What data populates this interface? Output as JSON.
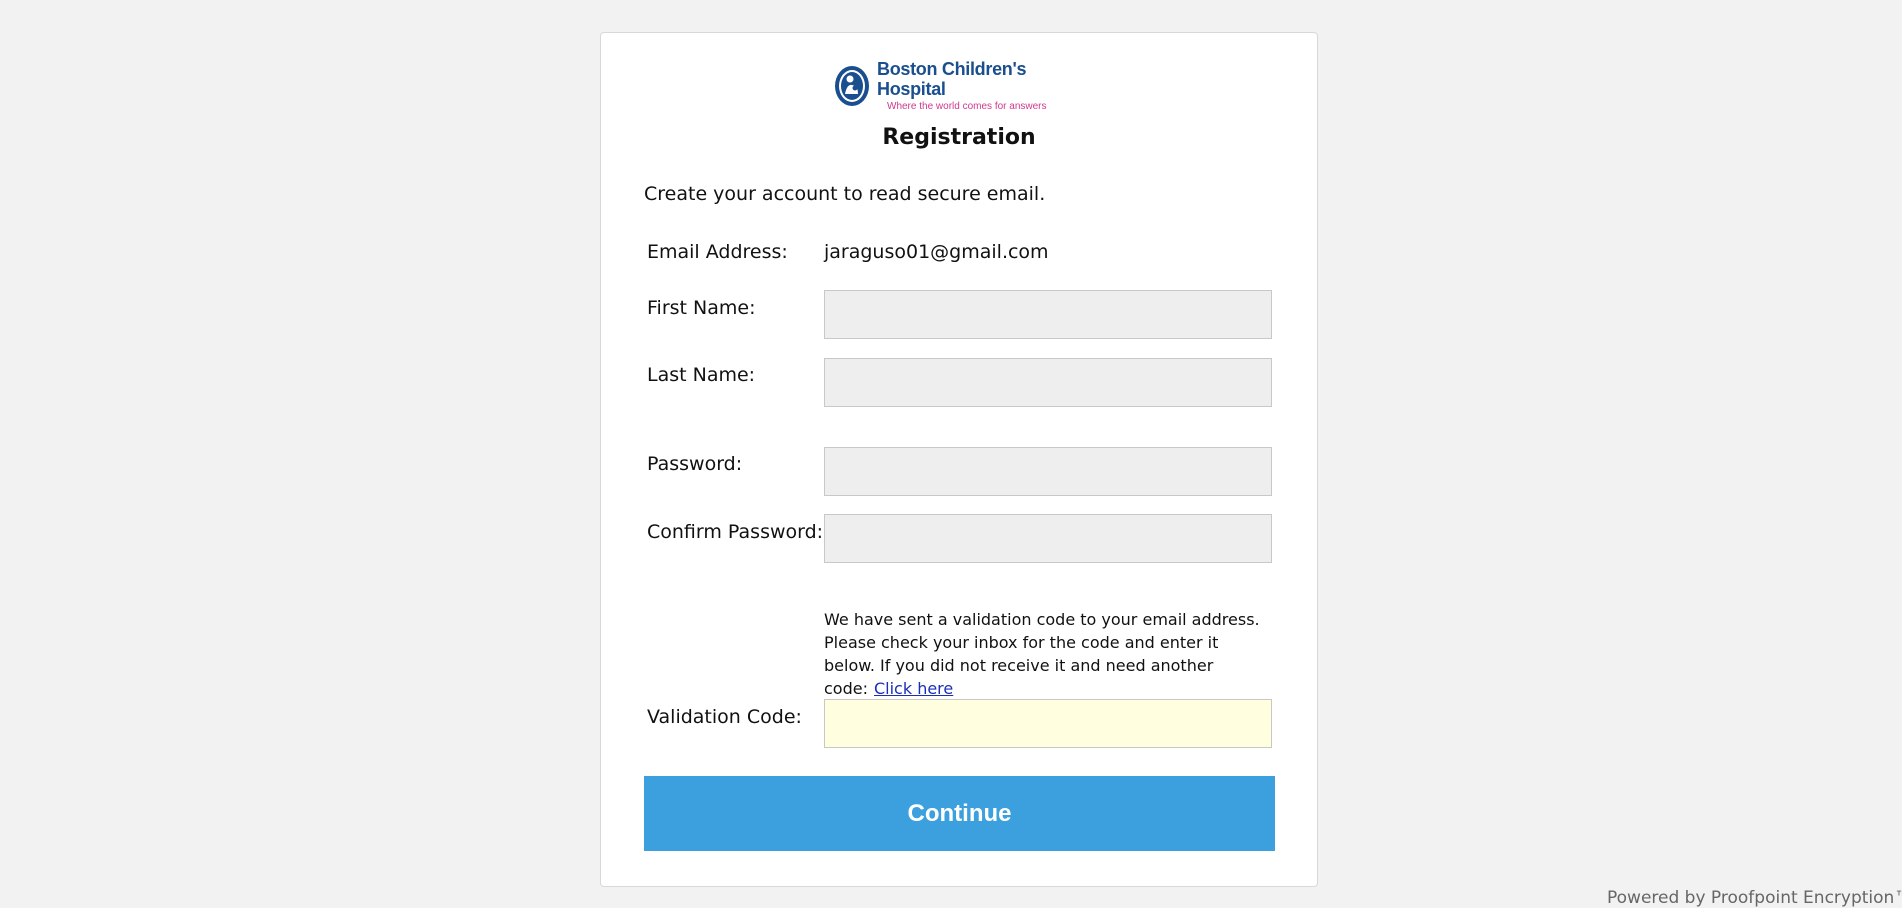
{
  "logo": {
    "name": "Boston Children's Hospital",
    "tagline": "Where the world comes for answers",
    "name_color": "#1a4f8f",
    "tagline_color": "#d0388f"
  },
  "form": {
    "title": "Registration",
    "intro": "Create your account to read secure email.",
    "email_label": "Email Address:",
    "email_value": "jaraguso01@gmail.com",
    "first_name_label": "First Name:",
    "first_name_value": "",
    "last_name_label": "Last Name:",
    "last_name_value": "",
    "password_label": "Password:",
    "password_value": "",
    "confirm_password_label": "Confirm Password:",
    "confirm_password_value": "",
    "validation_note": "We have sent a validation code to your email address. Please check your inbox for the code and enter it below. If you did not receive it and need another code:",
    "resend_link": "Click here",
    "validation_label": "Validation Code:",
    "validation_value": "",
    "continue_label": "Continue",
    "button_color": "#3ca0de",
    "validation_field_color": "#ffffe0"
  },
  "footer": {
    "powered_by": "Powered by Proofpoint Encryption™"
  }
}
